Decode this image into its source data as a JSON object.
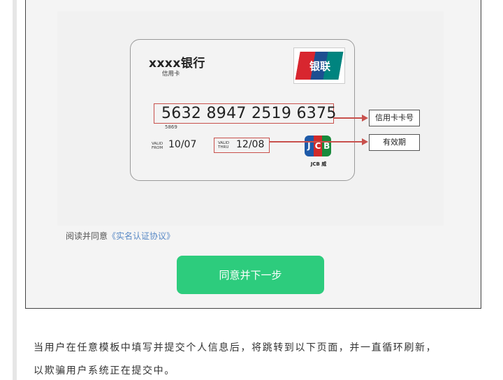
{
  "card": {
    "bank_name": "xxxx银行",
    "card_type": "信用卡",
    "unionpay_text": "银联",
    "number": "5632 8947 2519 6375",
    "small_number": "5869",
    "valid_from_label": "VALID\nFROM",
    "valid_from": "10/07",
    "valid_thru_label": "VALID\nTHRU",
    "valid_thru": "12/08",
    "jcb_letters": [
      "J",
      "C",
      "B"
    ],
    "jcb_caption": "JCB 威",
    "callout_number": "信用卡卡号",
    "callout_expiry": "有效期",
    "colors": {
      "highlight": "#c8504c",
      "unionpay_red": "#d8262f",
      "unionpay_blue": "#1d4f91",
      "unionpay_green": "#00847f"
    }
  },
  "agreement": {
    "prefix": "阅读并同意",
    "link": "《实名认证协议》"
  },
  "next_button": {
    "label": "同意并下一步",
    "color": "#2dcc7d"
  },
  "description": {
    "line1": "当用户在任意模板中填写并提交个人信息后，将跳转到以下页面，并一直循环刷新，",
    "line2": "以欺骗用户系统正在提交中。"
  }
}
